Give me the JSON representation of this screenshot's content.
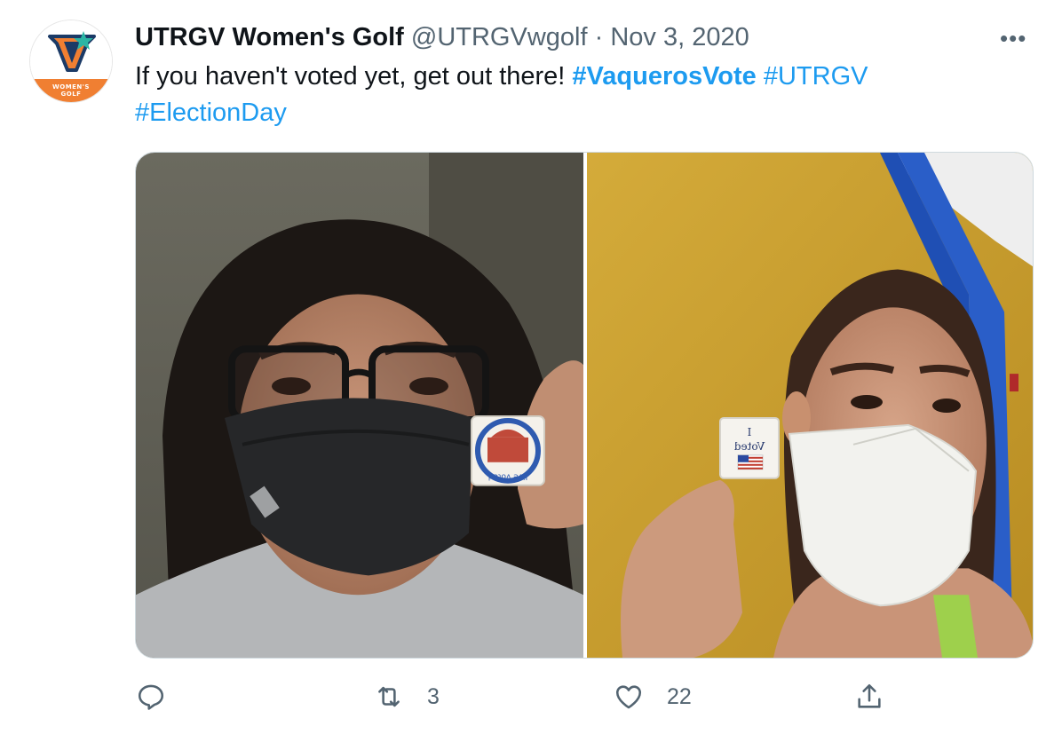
{
  "tweet": {
    "display_name": "UTRGV Women's Golf",
    "handle": "@UTRGVwgolf",
    "separator": "·",
    "date": "Nov 3, 2020",
    "more_label": "•••",
    "avatar_label_line1": "WOMEN'S",
    "avatar_label_line2": "GOLF",
    "text_prefix": "If you haven't voted yet, get out there! ",
    "hashtags": [
      "#VaquerosVote",
      "#UTRGV",
      "#ElectionDay"
    ]
  },
  "media": {
    "photos": [
      {
        "subject": "person-with-black-mask-and-sticker"
      },
      {
        "subject": "person-with-white-mask-and-i-voted-sticker"
      }
    ],
    "sticker_left_text": "I've voted",
    "sticker_right_line1": "I",
    "sticker_right_line2": "Voted"
  },
  "actions": {
    "reply_count": "",
    "retweet_count": "3",
    "like_count": "22",
    "icons": [
      "reply-icon",
      "retweet-icon",
      "like-icon",
      "share-icon"
    ]
  },
  "colors": {
    "link": "#1d9bf0",
    "secondary_text": "#536471",
    "brand_orange": "#f07f32",
    "brand_navy": "#1b3a66"
  }
}
